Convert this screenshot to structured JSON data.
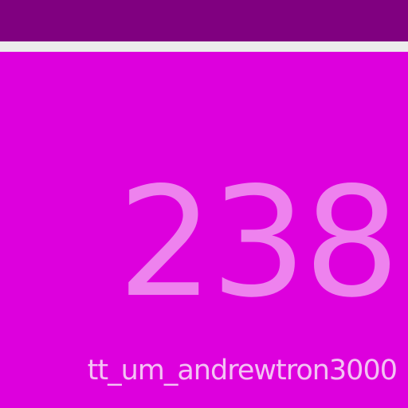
{
  "theme": {
    "top_bar_color": "#800080",
    "divider_color": "#ececec",
    "background_color": "#dd00dd",
    "counter_color": "#ee82ee",
    "username_color": "#f3c2f3"
  },
  "display": {
    "count": "238",
    "username": "tt_um_andrewtron3000"
  }
}
